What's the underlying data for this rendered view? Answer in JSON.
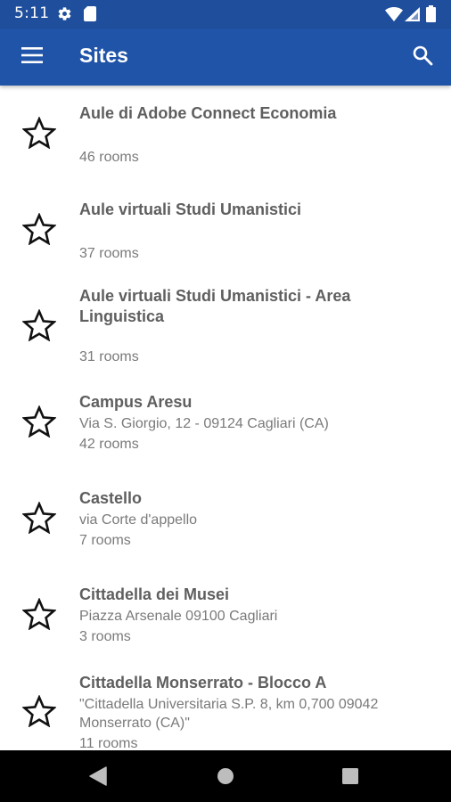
{
  "status_bar": {
    "time": "5:11",
    "icons": [
      "gear-icon",
      "sd-card-icon",
      "wifi-icon",
      "signal-icon",
      "battery-icon"
    ]
  },
  "app_bar": {
    "title": "Sites",
    "color": "#2054a8",
    "left_icon": "menu-icon",
    "right_icon": "search-icon"
  },
  "sites": [
    {
      "name": "Aule di Adobe Connect Economia",
      "address": "",
      "rooms": "46 rooms"
    },
    {
      "name": "Aule virtuali Studi Umanistici",
      "address": "",
      "rooms": "37 rooms"
    },
    {
      "name": "Aule virtuali Studi Umanistici - Area Linguistica",
      "address": "",
      "rooms": "31 rooms"
    },
    {
      "name": "Campus Aresu",
      "address": "Via S. Giorgio, 12 - 09124 Cagliari (CA)",
      "rooms": "42 rooms"
    },
    {
      "name": "Castello",
      "address": "via Corte d'appello",
      "rooms": "7 rooms"
    },
    {
      "name": "Cittadella dei Musei",
      "address": "Piazza Arsenale 09100 Cagliari",
      "rooms": "3 rooms"
    },
    {
      "name": "Cittadella Monserrato - Blocco A",
      "address": "\"Cittadella Universitaria  S.P. 8, km 0,700  09042 Monserrato (CA)\"",
      "rooms": "11 rooms"
    }
  ],
  "item_icon": "star-outline-icon",
  "nav_bar": {
    "icons": [
      "back-icon",
      "home-icon",
      "recents-icon"
    ]
  }
}
